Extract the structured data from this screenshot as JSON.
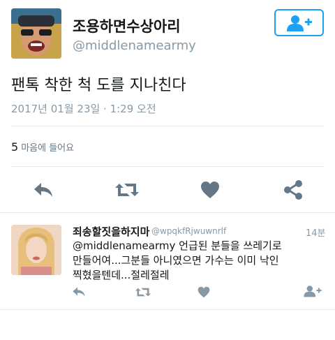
{
  "tweet": {
    "display_name": "조용하면수상아리",
    "handle": "@middlenamearmy",
    "text": "팬톡 착한 척 도를 지나친다",
    "timestamp": "2017년 01월 23일 · 1:29 오전",
    "like_count": "5",
    "like_label": "마음에 들어요"
  },
  "actions": [
    "reply-icon",
    "retweet-icon",
    "heart-icon",
    "share-icon"
  ],
  "follow_button": {
    "icon": "add-user-icon"
  },
  "reply": {
    "display_name": "죄송할짓을하지마",
    "handle": "@wpqkfRjwuwnrlf",
    "time": "14분",
    "mention": "@middlenamearmy",
    "text_line1_rest": " 언급된 분들을 쓰레기로",
    "text_line2": "만들어여...그분들 아니였으면 가수는 이미 낙인",
    "text_line3": "찍혔을텐데...절레절레",
    "actions": [
      "reply-icon",
      "retweet-icon",
      "heart-icon",
      "add-user-icon"
    ]
  },
  "colors": {
    "accent": "#1da1f2",
    "icon_gray": "#657786",
    "muted": "#8899a6"
  }
}
